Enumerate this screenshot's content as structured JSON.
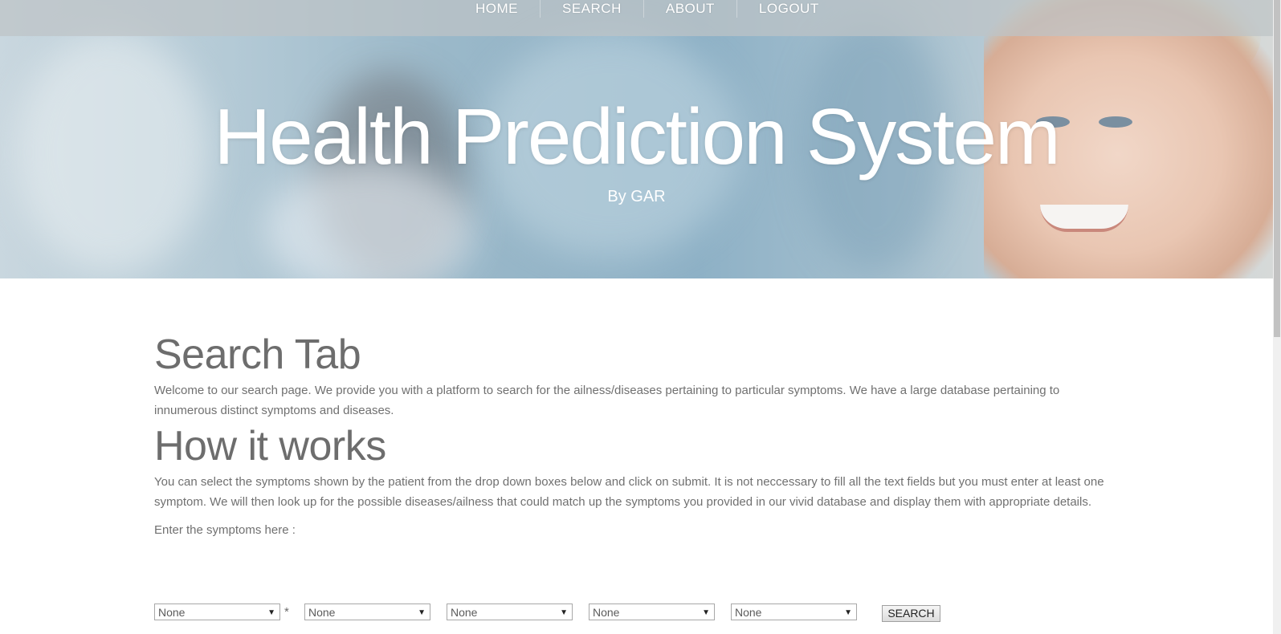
{
  "nav": {
    "items": [
      {
        "label": "HOME"
      },
      {
        "label": "SEARCH"
      },
      {
        "label": "ABOUT"
      },
      {
        "label": "LOGOUT"
      }
    ]
  },
  "hero": {
    "title": "Health Prediction System",
    "subtitle": "By GAR"
  },
  "search_tab": {
    "heading": "Search Tab",
    "description": "Welcome to our search page. We provide you with a platform to search for the ailness/diseases pertaining to particular symptoms. We have a large database pertaining to innumerous distinct symptoms and diseases."
  },
  "how_it_works": {
    "heading": "How it works",
    "description": "You can select the symptoms shown by the patient from the drop down boxes below and click on submit. It is not neccessary to fill all the text fields but you must enter at least one symptom. We will then look up for the possible diseases/ailness that could match up the symptoms you provided in our vivid database and display them with appropriate details."
  },
  "symptoms_form": {
    "label": "Enter the symptoms here :",
    "required_marker": "*",
    "selects": [
      {
        "value": "None"
      },
      {
        "value": "None"
      },
      {
        "value": "None"
      },
      {
        "value": "None"
      },
      {
        "value": "None"
      }
    ],
    "submit_label": "SEARCH"
  },
  "icons": {
    "dropdown_arrow": "chevron-down-icon"
  }
}
